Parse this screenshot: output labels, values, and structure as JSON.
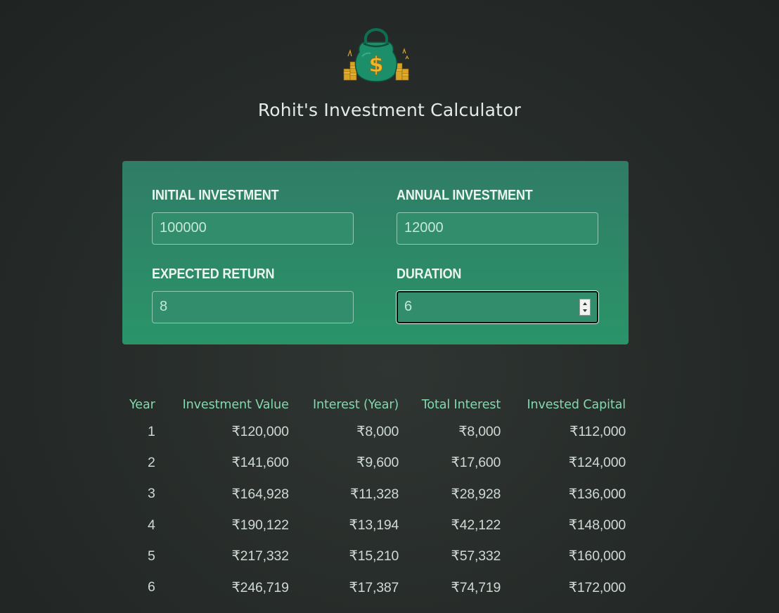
{
  "header": {
    "logo_icon": "money-bag-icon",
    "title": "Rohit's Investment Calculator"
  },
  "colors": {
    "background": "#282d2b",
    "panel_top": "#307c66",
    "panel_bottom": "#2a9469",
    "table_header": "#82d9ae",
    "text": "#cfd9d4"
  },
  "inputs": {
    "initial_investment": {
      "label": "INITIAL INVESTMENT",
      "value": "100000"
    },
    "annual_investment": {
      "label": "ANNUAL INVESTMENT",
      "value": "12000"
    },
    "expected_return": {
      "label": "EXPECTED RETURN",
      "value": "8"
    },
    "duration": {
      "label": "DURATION",
      "value": "6"
    }
  },
  "table": {
    "headers": [
      "Year",
      "Investment Value",
      "Interest (Year)",
      "Total Interest",
      "Invested Capital"
    ],
    "rows": [
      [
        "1",
        "₹120,000",
        "₹8,000",
        "₹8,000",
        "₹112,000"
      ],
      [
        "2",
        "₹141,600",
        "₹9,600",
        "₹17,600",
        "₹124,000"
      ],
      [
        "3",
        "₹164,928",
        "₹11,328",
        "₹28,928",
        "₹136,000"
      ],
      [
        "4",
        "₹190,122",
        "₹13,194",
        "₹42,122",
        "₹148,000"
      ],
      [
        "5",
        "₹217,332",
        "₹15,210",
        "₹57,332",
        "₹160,000"
      ],
      [
        "6",
        "₹246,719",
        "₹17,387",
        "₹74,719",
        "₹172,000"
      ]
    ]
  }
}
